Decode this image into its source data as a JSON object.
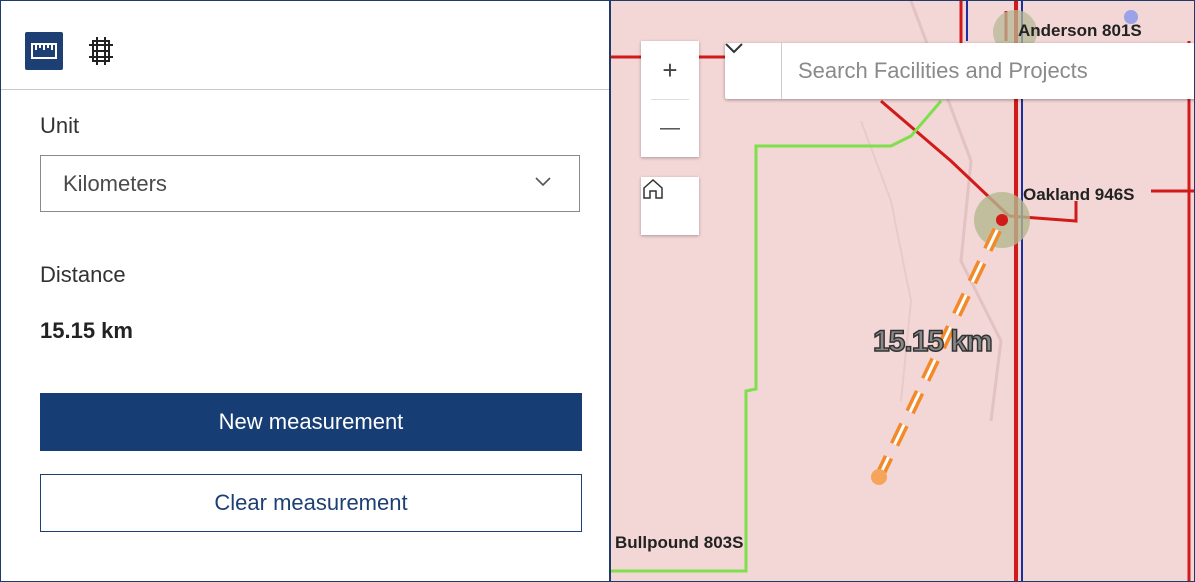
{
  "toolbar": {
    "tools": [
      {
        "name": "distance-measure-icon",
        "active": true
      },
      {
        "name": "area-measure-icon",
        "active": false
      }
    ]
  },
  "panel": {
    "unit_label": "Unit",
    "unit_value": "Kilometers",
    "distance_label": "Distance",
    "distance_value": "15.15 km",
    "new_button": "New measurement",
    "clear_button": "Clear measurement"
  },
  "map": {
    "zoom_in": "+",
    "zoom_out": "—",
    "search_placeholder": "Search Facilities and Projects",
    "labels": {
      "anderson": "Anderson 801S",
      "oakland": "Oakland 946S",
      "bullpound": "Bullpound 803S"
    },
    "measurement": "15.15 km"
  },
  "colors": {
    "primary": "#173d75",
    "map_bg": "#f3d6d6",
    "red_line": "#d11a1a",
    "blue_line": "#1a2fa0",
    "green_line": "#7ee04a",
    "measure_line": "#f28a2a"
  }
}
